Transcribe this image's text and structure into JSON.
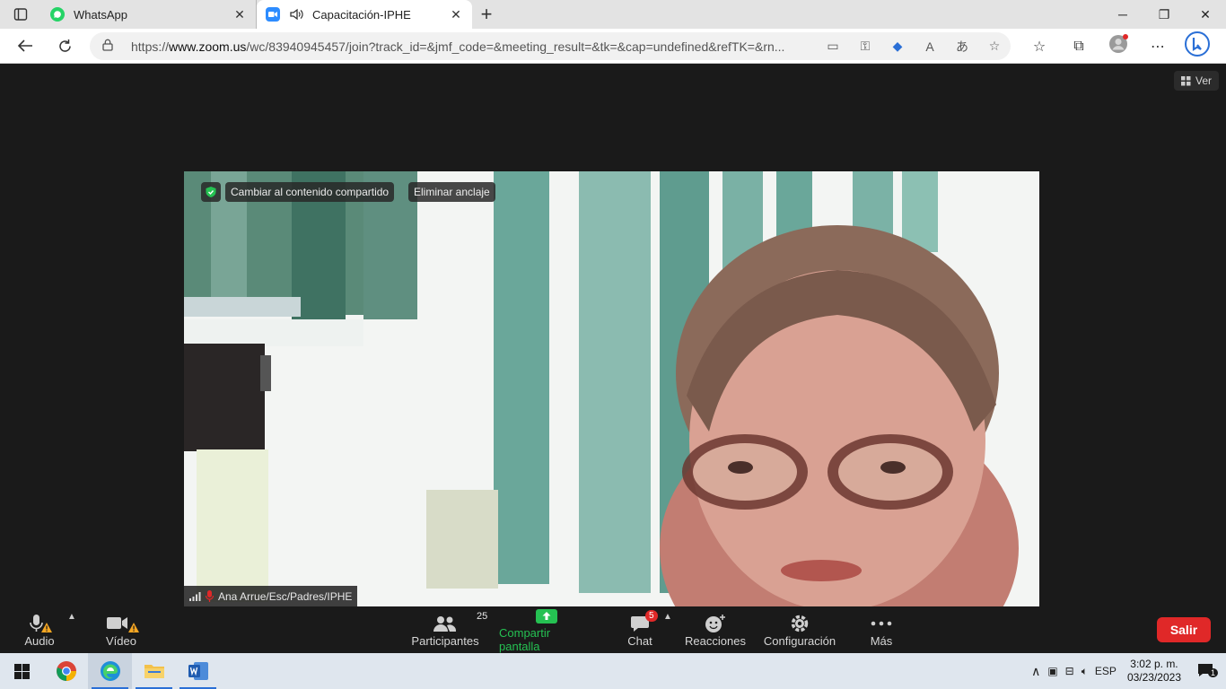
{
  "browser": {
    "tabs": [
      {
        "title": "WhatsApp",
        "favicon": "whatsapp-icon",
        "active": false
      },
      {
        "title": "Capacitación-IPHE",
        "favicon": "zoom-icon",
        "active": true
      }
    ],
    "url_prefix": "https://",
    "url_domain": "www.zoom.us",
    "url_path": "/wc/83940945457/join?track_id=&jmf_code=&meeting_result=&tk=&cap=undefined&refTK=&rn..."
  },
  "zoom": {
    "view_label": "Ver",
    "badges": {
      "switch_shared": "Cambiar al contenido compartido",
      "unpin": "Eliminar anclaje"
    },
    "participant_name": "Ana Arrue/Esc/Padres/IPHE",
    "toolbar": {
      "audio": "Audio",
      "video": "Vídeo",
      "participants": "Participantes",
      "participants_count": "25",
      "share": "Compartir pantalla",
      "chat": "Chat",
      "chat_badge": "5",
      "reactions": "Reacciones",
      "settings": "Configuración",
      "more": "Más",
      "exit": "Salir"
    },
    "colors": {
      "share_green": "#25c152",
      "exit_red": "#e02828",
      "badge_red": "#e02828"
    }
  },
  "taskbar": {
    "language": "ESP",
    "time": "3:02 p. m.",
    "date": "03/23/2023",
    "notifications": "1"
  }
}
